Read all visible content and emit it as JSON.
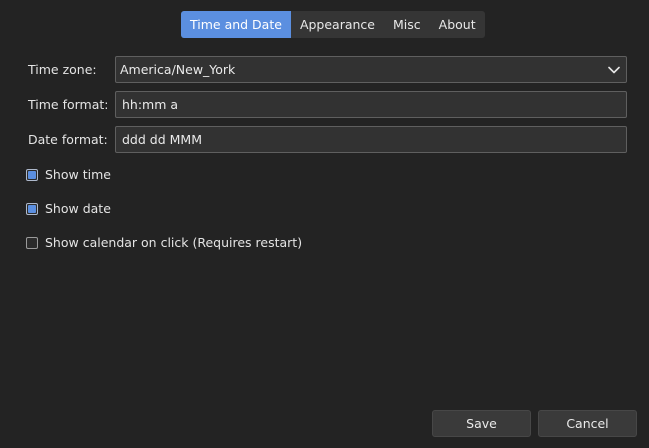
{
  "tabs": [
    {
      "label": "Time and Date",
      "active": true
    },
    {
      "label": "Appearance",
      "active": false
    },
    {
      "label": "Misc",
      "active": false
    },
    {
      "label": "About",
      "active": false
    }
  ],
  "form": {
    "time_zone": {
      "label": "Time zone:",
      "value": "America/New_York",
      "icon": "chevron-down-icon"
    },
    "time_format": {
      "label": "Time format:",
      "value": "hh:mm a"
    },
    "date_format": {
      "label": "Date format:",
      "value": "ddd dd MMM"
    }
  },
  "options": {
    "show_time": {
      "label": "Show time",
      "checked": true
    },
    "show_date": {
      "label": "Show date",
      "checked": true
    },
    "show_calendar": {
      "label": "Show calendar on click (Requires restart)",
      "checked": false
    }
  },
  "buttons": {
    "save": "Save",
    "cancel": "Cancel"
  },
  "colors": {
    "background": "#232323",
    "accent": "#5b8fe0",
    "field_background": "#323232",
    "field_border": "#5f5f5f"
  }
}
